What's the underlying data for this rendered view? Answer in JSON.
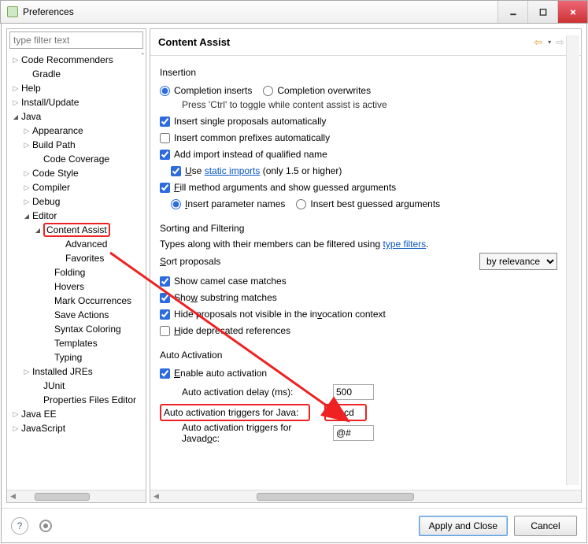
{
  "window": {
    "title": "Preferences"
  },
  "filter": {
    "placeholder": "type filter text"
  },
  "tree": {
    "code_recommenders": "Code Recommenders",
    "gradle": "Gradle",
    "help": "Help",
    "install_update": "Install/Update",
    "java": "Java",
    "appearance": "Appearance",
    "build_path": "Build Path",
    "code_coverage": "Code Coverage",
    "code_style": "Code Style",
    "compiler": "Compiler",
    "debug": "Debug",
    "editor": "Editor",
    "content_assist": "Content Assist",
    "advanced": "Advanced",
    "favorites": "Favorites",
    "folding": "Folding",
    "hovers": "Hovers",
    "mark_occurrences": "Mark Occurrences",
    "save_actions": "Save Actions",
    "syntax_coloring": "Syntax Coloring",
    "templates": "Templates",
    "typing": "Typing",
    "installed_jres": "Installed JREs",
    "junit": "JUnit",
    "properties_files": "Properties Files Editor",
    "java_ee": "Java EE",
    "javascript": "JavaScript"
  },
  "page": {
    "title": "Content Assist",
    "insertion_title": "Insertion",
    "completion_inserts": "Completion inserts",
    "completion_overwrites": "Completion overwrites",
    "ctrl_help": "Press 'Ctrl' to toggle while content assist is active",
    "insert_single": "Insert single proposals automatically",
    "insert_common": "Insert common prefixes automatically",
    "add_import": "Add import instead of qualified name",
    "use_static_pre": "U",
    "use_static_rest": "se ",
    "static_imports_link": "static imports",
    "static_imports_suffix": " (only 1.5 or higher)",
    "fill_method_pre": "F",
    "fill_method_rest": "ill method arguments and show guessed arguments",
    "insert_param_pre": "I",
    "insert_param_rest": "nsert parameter names",
    "insert_best": "Insert best guessed arguments",
    "sorting_title": "Sorting and Filtering",
    "types_along": "Types along with their members can be filtered using ",
    "type_filters_link": "type filters",
    "sort_proposals_pre": "S",
    "sort_proposals_rest": "ort proposals",
    "by_relevance": "by relevance",
    "show_camel": "Show camel case matches",
    "show_substring_pre": "Sho",
    "show_substring_u": "w",
    "show_substring_rest": " substring matches",
    "hide_proposals_pre": "Hide proposals not visible in the in",
    "hide_proposals_u": "v",
    "hide_proposals_rest": "ocation context",
    "hide_deprecated_pre": "H",
    "hide_deprecated_rest": "ide deprecated references",
    "auto_activation_title": "Auto Activation",
    "enable_auto_pre": "E",
    "enable_auto_rest": "nable auto activation",
    "delay_label": "Auto activation delay (ms):",
    "delay_value": "500",
    "triggers_java_label": "Auto activation triggers for Java:",
    "triggers_java_value": ".abcd",
    "triggers_javadoc_label_pre": "Auto activation triggers for Javad",
    "triggers_javadoc_label_u": "o",
    "triggers_javadoc_label_rest": "c:",
    "triggers_javadoc_value": "@#"
  },
  "buttons": {
    "apply_close": "Apply and Close",
    "cancel": "Cancel"
  }
}
